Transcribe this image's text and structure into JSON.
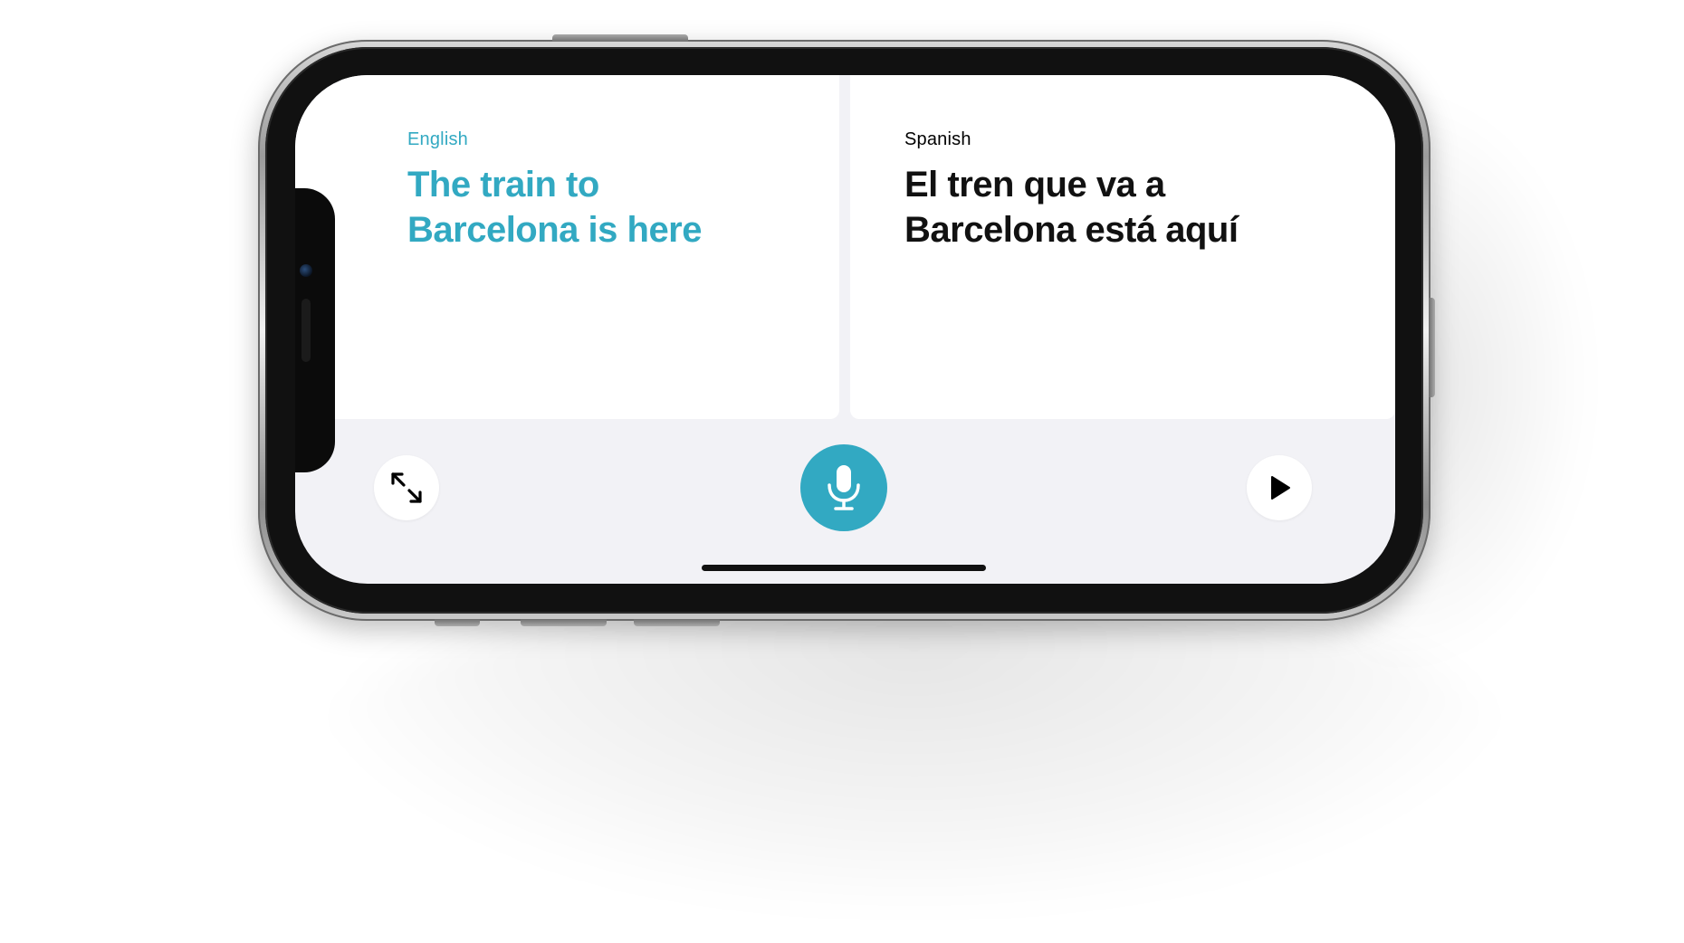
{
  "app": {
    "accent_color": "#32a9c2"
  },
  "source": {
    "language": "English",
    "text": "The train to\nBarcelona is here"
  },
  "target": {
    "language": "Spanish",
    "text": "El tren que va a\nBarcelona está aquí"
  },
  "controls": {
    "expand_icon": "expand-arrows-icon",
    "mic_icon": "microphone-icon",
    "play_icon": "play-icon"
  }
}
